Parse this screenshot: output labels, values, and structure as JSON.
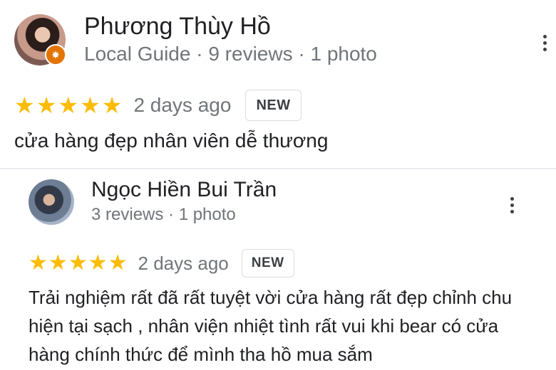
{
  "reviews": [
    {
      "reviewer": "Phương Thùy Hồ",
      "meta": "Local Guide · 9 reviews · 1 photo",
      "is_local_guide": true,
      "rating": 5,
      "date": "2 days ago",
      "badge": "NEW",
      "text": "cửa hàng đẹp nhân viên dễ thương"
    },
    {
      "reviewer": "Ngọc Hiền Bui Trần",
      "meta": "3 reviews · 1 photo",
      "is_local_guide": false,
      "rating": 5,
      "date": "2 days ago",
      "badge": "NEW",
      "text": "Trải nghiệm rất đã rất tuyệt vời cửa hàng rất đẹp chỉnh chu hiện tại sạch , nhân viện nhiệt tình rất vui khi bear có cửa hàng chính thức để mình tha hồ mua sắm"
    }
  ],
  "icons": {
    "star": "star-icon",
    "menu": "more-vert-icon",
    "local_guide": "local-guide-badge-icon"
  },
  "colors": {
    "star": "#fbbc04",
    "local_guide_badge": "#e37400",
    "secondary_text": "#70757a",
    "primary_text": "#202124"
  }
}
